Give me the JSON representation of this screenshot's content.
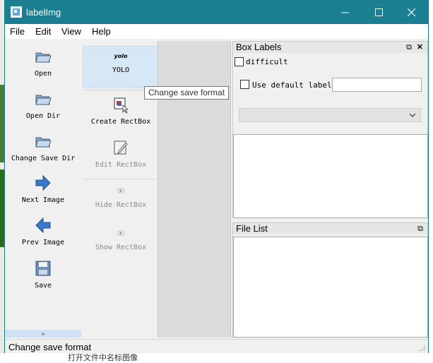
{
  "window": {
    "title": "labelImg",
    "minimize": "—",
    "maximize": "☐",
    "close": "✕"
  },
  "menu": [
    "File",
    "Edit",
    "View",
    "Help"
  ],
  "toolbar_left": [
    {
      "label": "Open",
      "icon": "folder-icon"
    },
    {
      "label": "Open Dir",
      "icon": "folder-icon"
    },
    {
      "label": "Change Save Dir",
      "icon": "folder-icon"
    },
    {
      "label": "Next Image",
      "icon": "arrow-right-icon"
    },
    {
      "label": "Prev Image",
      "icon": "arrow-left-icon"
    },
    {
      "label": "Save",
      "icon": "floppy-disk-icon"
    }
  ],
  "toolbar_right": {
    "format": {
      "icon_text": "yolo",
      "label": "YOLO"
    },
    "create": "Create RectBox",
    "edit": "Edit RectBox",
    "hide": "Hide RectBox",
    "show": "Show RectBox"
  },
  "expander": "»",
  "tooltip": "Change save format",
  "box_labels": {
    "title": "Box Labels",
    "difficult": "difficult",
    "use_default_label": "Use default label",
    "default_label_value": ""
  },
  "file_list": {
    "title": "File List"
  },
  "status": "Change save format",
  "background_text": "打开文件中名标图像",
  "colors": {
    "titlebar": "#1a7f91",
    "selected_tool": "#d6e7f5",
    "arrow_blue": "#3a78c9"
  }
}
